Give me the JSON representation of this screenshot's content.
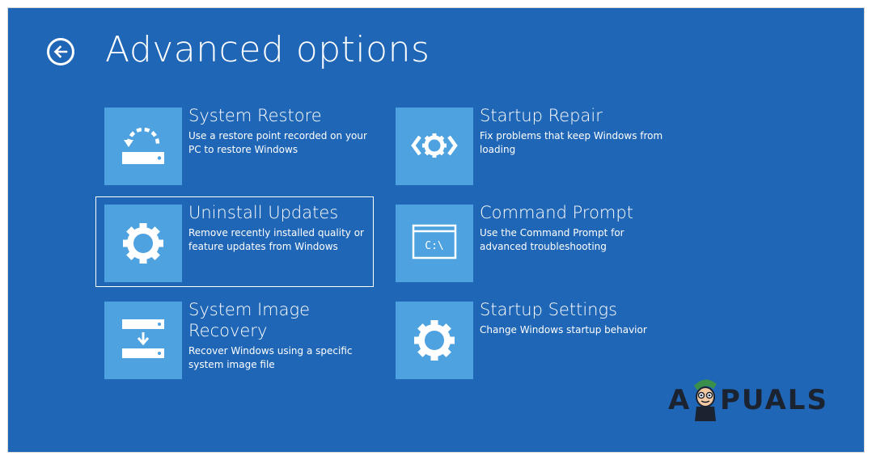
{
  "page": {
    "title": "Advanced options"
  },
  "back": {
    "icon": "back-arrow-icon"
  },
  "options": [
    {
      "id": "system-restore",
      "title": "System Restore",
      "description": "Use a restore point recorded on your PC to restore Windows",
      "icon": "restore-icon"
    },
    {
      "id": "startup-repair",
      "title": "Startup Repair",
      "description": "Fix problems that keep Windows from loading",
      "icon": "repair-code-icon"
    },
    {
      "id": "uninstall-updates",
      "title": "Uninstall Updates",
      "description": "Remove recently installed quality or feature updates from Windows",
      "icon": "gear-icon",
      "selected": true
    },
    {
      "id": "command-prompt",
      "title": "Command Prompt",
      "description": "Use the Command Prompt for advanced troubleshooting",
      "icon": "command-prompt-icon",
      "glyph": "C:\\"
    },
    {
      "id": "system-image-recovery",
      "title": "System Image Recovery",
      "description": "Recover Windows using a specific system image file",
      "icon": "image-recovery-icon"
    },
    {
      "id": "startup-settings",
      "title": "Startup Settings",
      "description": "Change Windows startup behavior",
      "icon": "gear-icon"
    }
  ],
  "watermark": {
    "text_left": "A",
    "text_right": "PUALS"
  },
  "colors": {
    "background": "#1F66B7",
    "tile": "#4EA2E0",
    "text": "#FFFFFF",
    "selection_border": "#FFFFFF"
  }
}
